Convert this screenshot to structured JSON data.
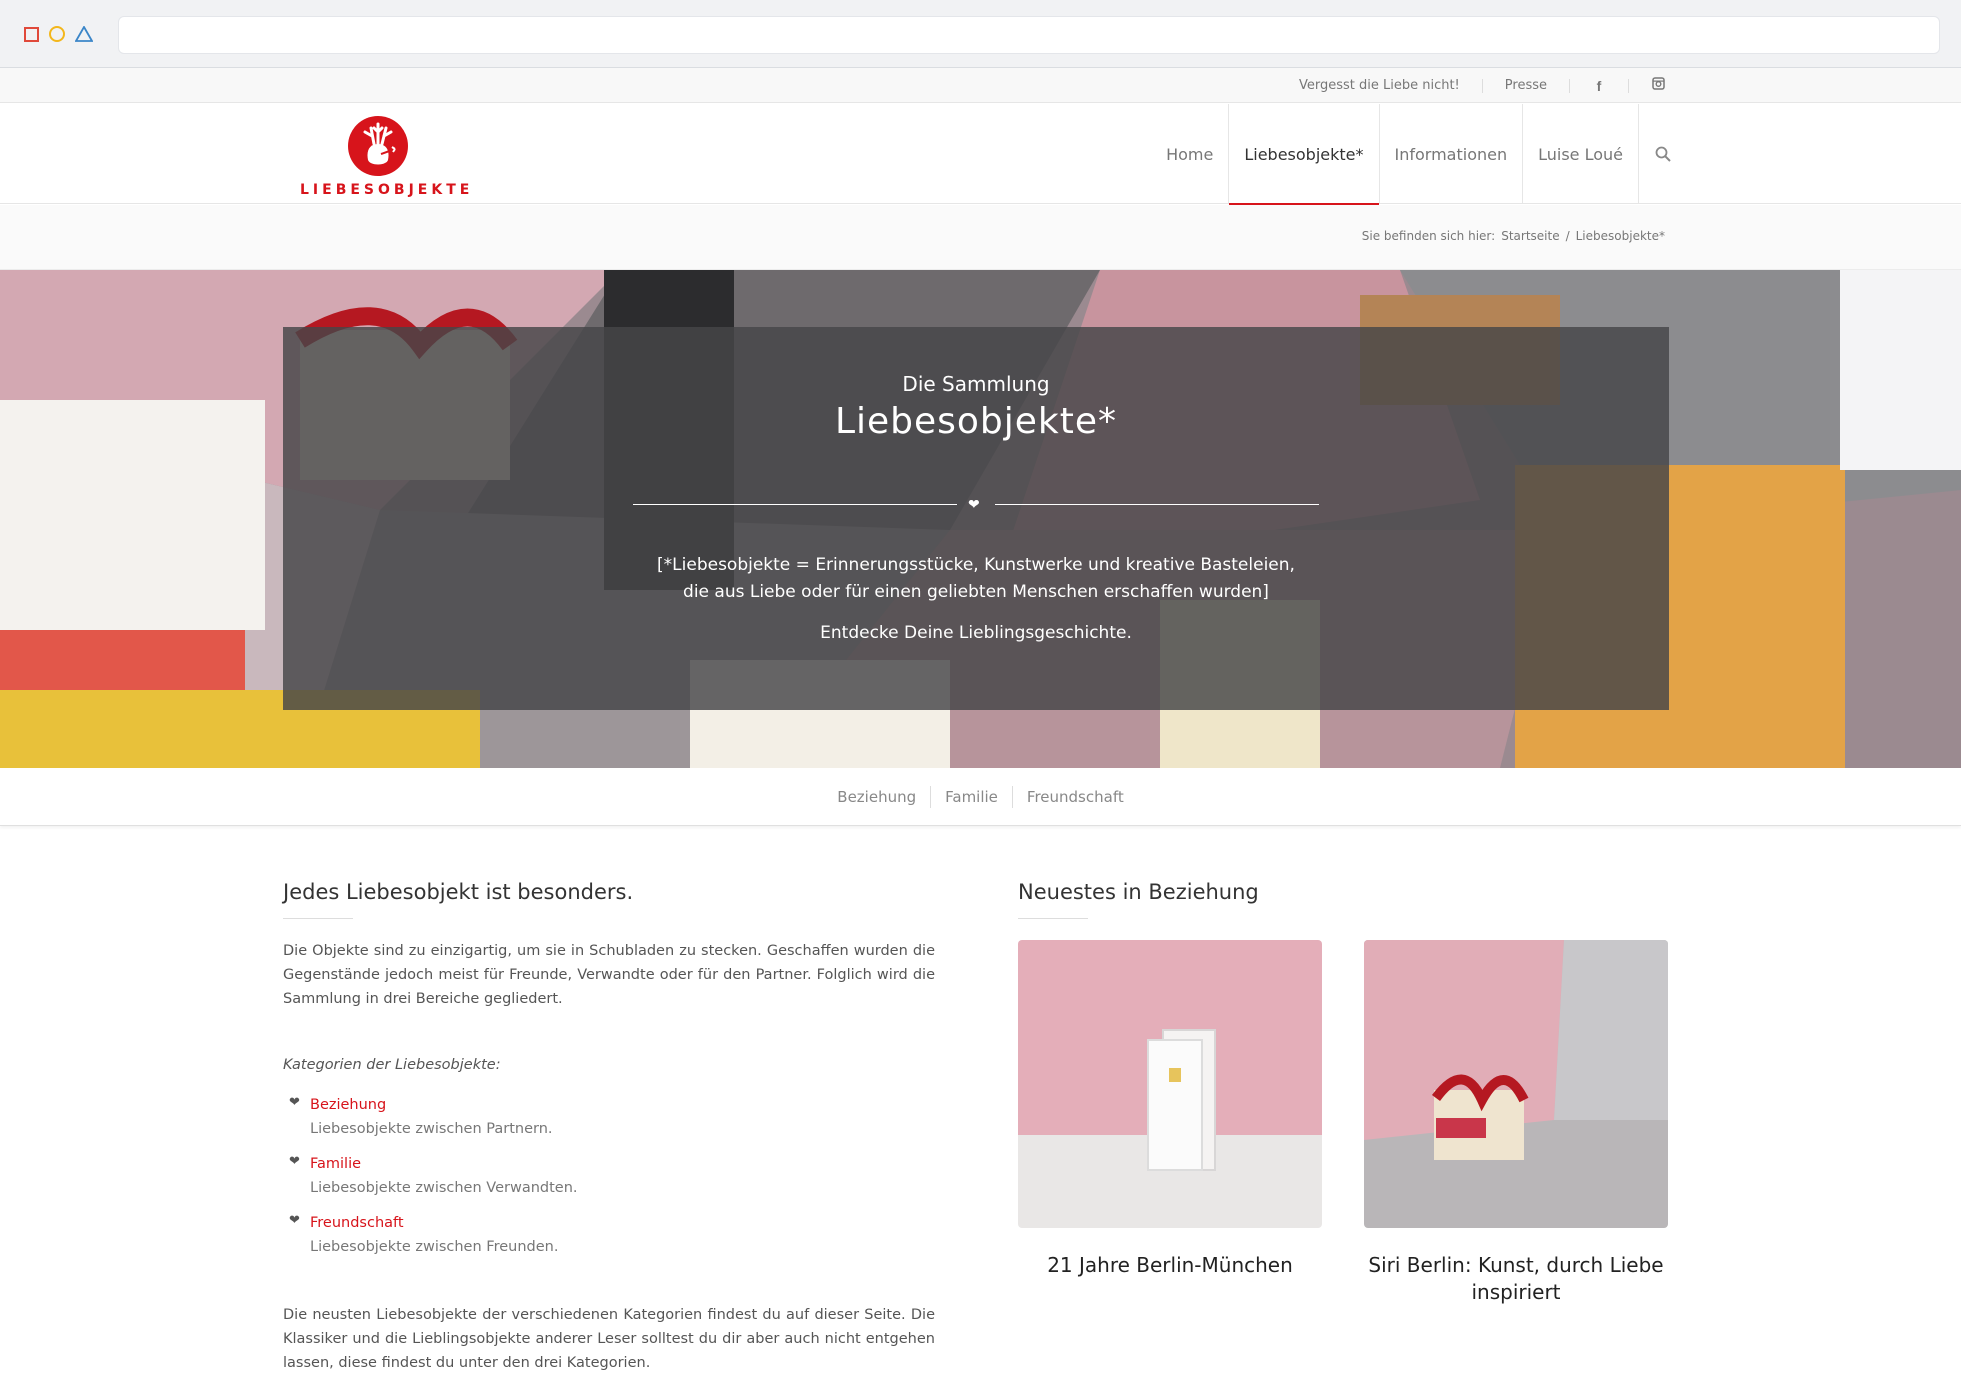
{
  "topbar": {
    "link1": "Vergesst die Liebe nicht!",
    "link2": "Presse",
    "icon1": "facebook-icon",
    "icon2": "instagram-icon"
  },
  "logo": {
    "text": "LIEBESOBJEKTE"
  },
  "nav": {
    "items": [
      "Home",
      "Liebesobjekte*",
      "Informationen",
      "Luise Loué"
    ],
    "active": "Liebesobjekte*"
  },
  "breadcrumb": {
    "prefix": "Sie befinden sich hier:",
    "home": "Startseite",
    "separator": "/",
    "current": "Liebesobjekte*"
  },
  "hero": {
    "pre": "Die Sammlung",
    "title": "Liebesobjekte*",
    "line1": "[*Liebesobjekte = Erinnerungsstücke, Kunstwerke und kreative Basteleien,",
    "line2": "die aus Liebe oder für einen geliebten Menschen erschaffen wurden]",
    "cta": "Entdecke Deine Lieblingsgeschichte."
  },
  "subnav": {
    "items": [
      "Beziehung",
      "Familie",
      "Freundschaft"
    ]
  },
  "left": {
    "heading": "Jedes Liebesobjekt ist besonders.",
    "intro": "Die Objekte sind zu einzigartig, um sie in Schubladen zu stecken. Geschaffen wurden die Gegenstände jedoch meist für Freunde, Verwandte oder für den Partner. Folglich wird die Sammlung in drei Bereiche gegliedert.",
    "categories_heading": "Kategorien der Liebesobjekte:",
    "categories": [
      {
        "name": "Beziehung",
        "desc": "Liebesobjekte zwischen Partnern."
      },
      {
        "name": "Familie",
        "desc": "Liebesobjekte zwischen Verwandten."
      },
      {
        "name": "Freundschaft",
        "desc": "Liebesobjekte zwischen Freunden."
      }
    ],
    "outro": "Die neusten Liebesobjekte der verschiedenen Kategorien findest du auf dieser Seite. Die Klassiker und die Lieblingsobjekte anderer Leser solltest du dir aber auch nicht entgehen lassen, diese findest du unter den drei Kategorien."
  },
  "right": {
    "heading": "Neuestes in Beziehung",
    "cards": [
      {
        "title": "21 Jahre Berlin-München"
      },
      {
        "title": "Siri Berlin: Kunst, durch Liebe inspiriert"
      }
    ]
  },
  "colors": {
    "accent": "#d7141b",
    "text": "#555555",
    "heading": "#333333"
  }
}
